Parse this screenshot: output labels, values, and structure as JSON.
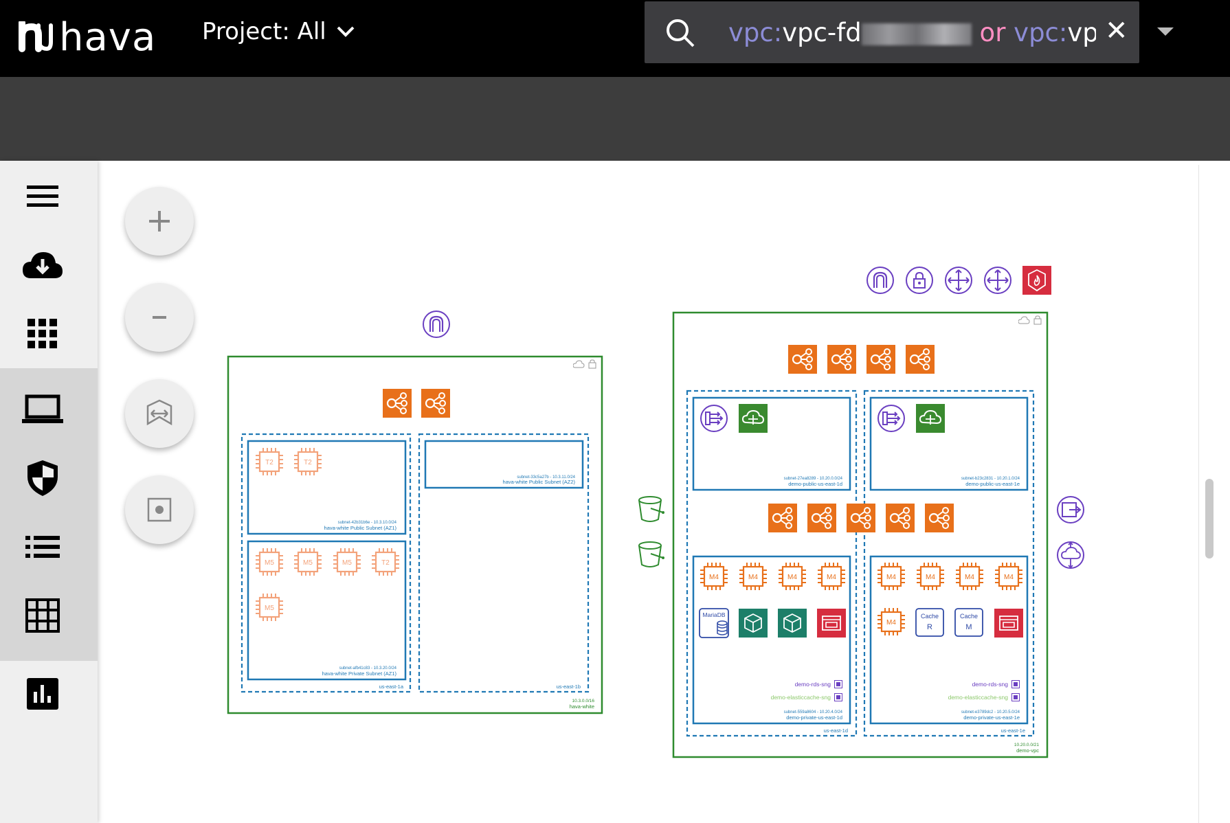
{
  "app": {
    "logo_text": "hava"
  },
  "project_selector": {
    "label": "Project: All"
  },
  "search": {
    "query_key_1": "vpc:",
    "query_val_1": "vpc-fd",
    "query_op": " or ",
    "query_key_2": "vpc:",
    "query_val_2": "vpc"
  },
  "sidebar": {
    "items": [
      "menu",
      "download",
      "apps",
      "infrastructure",
      "security",
      "list",
      "grid",
      "reports"
    ]
  },
  "zoom_controls": [
    "zoom-in",
    "zoom-out",
    "fit",
    "center"
  ],
  "diagram": {
    "vpc_left": {
      "cidr": "10.3.0.0/16",
      "name": "hava-white",
      "az1": "us-east-1a",
      "az2": "us-east-1b",
      "subnet_pub1": {
        "id": "subnet-42b31b6e - 10.3.10.0/24",
        "name": "hava-white Public Subnet (AZ1)",
        "instances": [
          "T2",
          "T2"
        ]
      },
      "subnet_pub2": {
        "id": "subnet-33c5a27b - 10.3.11.0/24",
        "name": "hava-white Public Subnet (AZ2)"
      },
      "subnet_priv1": {
        "id": "subnet-afb41c83 - 10.3.20.0/24",
        "name": "hava-white Private Subnet (AZ1)",
        "instances": [
          "M5",
          "M5",
          "M5",
          "T2",
          "M5"
        ]
      }
    },
    "vpc_right": {
      "cidr": "10.20.0.0/21",
      "name": "demo-vpc",
      "az1": "us-east-1d",
      "az2": "us-east-1e",
      "pub1": {
        "id": "subnet-27ea8289 - 10.20.0.0/24",
        "name": "demo-public-us-east-1d"
      },
      "pub2": {
        "id": "subnet-b23c2831 - 10.20.1.0/24",
        "name": "demo-public-us-east-1e"
      },
      "priv1": {
        "id": "subnet-559a8604 - 10.20.4.0/24",
        "name": "demo-private-us-east-1d",
        "instances": [
          "M4",
          "M4",
          "M4",
          "M4"
        ],
        "db": "MariaDB",
        "rds_sng": "demo-rds-sng",
        "cache_sng": "demo-elasticcache-sng"
      },
      "priv2": {
        "id": "subnet-e3789dc2 - 10.20.5.0/24",
        "name": "demo-private-us-east-1e",
        "instances": [
          "M4",
          "M4",
          "M4",
          "M4",
          "M4"
        ],
        "cache_r": "Cache",
        "cache_r_letter": "R",
        "cache_m": "Cache",
        "cache_m_letter": "M",
        "rds_sng": "demo-rds-sng",
        "cache_sng": "demo-elasticcache-sng"
      }
    }
  },
  "colors": {
    "topbar": "#000000",
    "subbar": "#3d3d3d",
    "vpc": "#2e8b2e",
    "subnet": "#1f78b4",
    "ec2": "#e8701a",
    "purple": "#6a3fc1",
    "green": "#3a8a2f",
    "teal": "#1d7f69",
    "red": "#d62d3f"
  }
}
